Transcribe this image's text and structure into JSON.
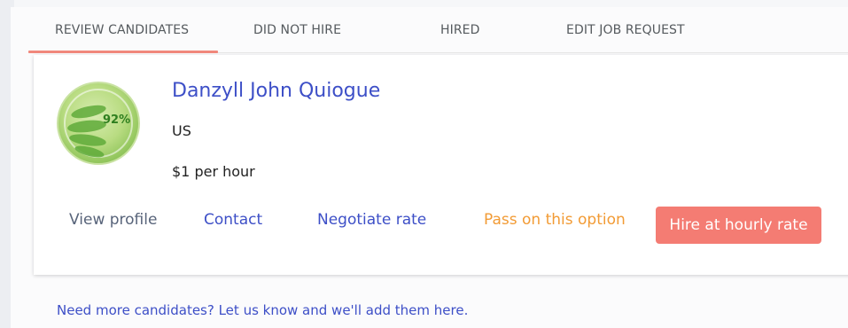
{
  "tabs": [
    {
      "label": "REVIEW CANDIDATES",
      "active": true
    },
    {
      "label": "DID NOT HIRE",
      "active": false
    },
    {
      "label": "HIRED",
      "active": false
    },
    {
      "label": "EDIT JOB REQUEST",
      "active": false
    }
  ],
  "candidate": {
    "name": "Danzyll John Quiogue",
    "country": "US",
    "rate": "$1 per hour",
    "avatar_text": "92%"
  },
  "actions": {
    "view_profile": "View profile",
    "contact": "Contact",
    "negotiate": "Negotiate rate",
    "pass": "Pass on this option",
    "hire": "Hire at hourly rate"
  },
  "footer": {
    "more_candidates": "Need more candidates? Let us know and we'll add them here."
  },
  "colors": {
    "accent_blue": "#3d4fc7",
    "pass_orange": "#f29b35",
    "hire_button": "#f47c73",
    "active_tab_underline": "#f1887c"
  }
}
